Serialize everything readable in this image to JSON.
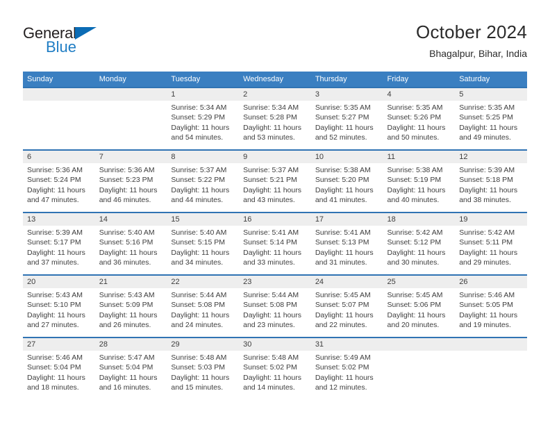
{
  "logo": {
    "word_one": "General",
    "word_two": "Blue",
    "triangle_color": "#0b6cb5",
    "text_color": "#231f20",
    "blue_color": "#1f7dc4"
  },
  "header": {
    "title": "October 2024",
    "subtitle": "Bhagalpur, Bihar, India"
  },
  "theme": {
    "header_row_bg": "#3a7fc1",
    "row_divider": "#2f73b3",
    "day_number_bg": "#eeeeee",
    "text": "#3d3d3d"
  },
  "weekday_headers": [
    "Sunday",
    "Monday",
    "Tuesday",
    "Wednesday",
    "Thursday",
    "Friday",
    "Saturday"
  ],
  "weeks": [
    [
      {
        "day": "",
        "sunrise": "",
        "sunset": "",
        "daylight": ""
      },
      {
        "day": "",
        "sunrise": "",
        "sunset": "",
        "daylight": ""
      },
      {
        "day": "1",
        "sunrise": "Sunrise: 5:34 AM",
        "sunset": "Sunset: 5:29 PM",
        "daylight": "Daylight: 11 hours and 54 minutes."
      },
      {
        "day": "2",
        "sunrise": "Sunrise: 5:34 AM",
        "sunset": "Sunset: 5:28 PM",
        "daylight": "Daylight: 11 hours and 53 minutes."
      },
      {
        "day": "3",
        "sunrise": "Sunrise: 5:35 AM",
        "sunset": "Sunset: 5:27 PM",
        "daylight": "Daylight: 11 hours and 52 minutes."
      },
      {
        "day": "4",
        "sunrise": "Sunrise: 5:35 AM",
        "sunset": "Sunset: 5:26 PM",
        "daylight": "Daylight: 11 hours and 50 minutes."
      },
      {
        "day": "5",
        "sunrise": "Sunrise: 5:35 AM",
        "sunset": "Sunset: 5:25 PM",
        "daylight": "Daylight: 11 hours and 49 minutes."
      }
    ],
    [
      {
        "day": "6",
        "sunrise": "Sunrise: 5:36 AM",
        "sunset": "Sunset: 5:24 PM",
        "daylight": "Daylight: 11 hours and 47 minutes."
      },
      {
        "day": "7",
        "sunrise": "Sunrise: 5:36 AM",
        "sunset": "Sunset: 5:23 PM",
        "daylight": "Daylight: 11 hours and 46 minutes."
      },
      {
        "day": "8",
        "sunrise": "Sunrise: 5:37 AM",
        "sunset": "Sunset: 5:22 PM",
        "daylight": "Daylight: 11 hours and 44 minutes."
      },
      {
        "day": "9",
        "sunrise": "Sunrise: 5:37 AM",
        "sunset": "Sunset: 5:21 PM",
        "daylight": "Daylight: 11 hours and 43 minutes."
      },
      {
        "day": "10",
        "sunrise": "Sunrise: 5:38 AM",
        "sunset": "Sunset: 5:20 PM",
        "daylight": "Daylight: 11 hours and 41 minutes."
      },
      {
        "day": "11",
        "sunrise": "Sunrise: 5:38 AM",
        "sunset": "Sunset: 5:19 PM",
        "daylight": "Daylight: 11 hours and 40 minutes."
      },
      {
        "day": "12",
        "sunrise": "Sunrise: 5:39 AM",
        "sunset": "Sunset: 5:18 PM",
        "daylight": "Daylight: 11 hours and 38 minutes."
      }
    ],
    [
      {
        "day": "13",
        "sunrise": "Sunrise: 5:39 AM",
        "sunset": "Sunset: 5:17 PM",
        "daylight": "Daylight: 11 hours and 37 minutes."
      },
      {
        "day": "14",
        "sunrise": "Sunrise: 5:40 AM",
        "sunset": "Sunset: 5:16 PM",
        "daylight": "Daylight: 11 hours and 36 minutes."
      },
      {
        "day": "15",
        "sunrise": "Sunrise: 5:40 AM",
        "sunset": "Sunset: 5:15 PM",
        "daylight": "Daylight: 11 hours and 34 minutes."
      },
      {
        "day": "16",
        "sunrise": "Sunrise: 5:41 AM",
        "sunset": "Sunset: 5:14 PM",
        "daylight": "Daylight: 11 hours and 33 minutes."
      },
      {
        "day": "17",
        "sunrise": "Sunrise: 5:41 AM",
        "sunset": "Sunset: 5:13 PM",
        "daylight": "Daylight: 11 hours and 31 minutes."
      },
      {
        "day": "18",
        "sunrise": "Sunrise: 5:42 AM",
        "sunset": "Sunset: 5:12 PM",
        "daylight": "Daylight: 11 hours and 30 minutes."
      },
      {
        "day": "19",
        "sunrise": "Sunrise: 5:42 AM",
        "sunset": "Sunset: 5:11 PM",
        "daylight": "Daylight: 11 hours and 29 minutes."
      }
    ],
    [
      {
        "day": "20",
        "sunrise": "Sunrise: 5:43 AM",
        "sunset": "Sunset: 5:10 PM",
        "daylight": "Daylight: 11 hours and 27 minutes."
      },
      {
        "day": "21",
        "sunrise": "Sunrise: 5:43 AM",
        "sunset": "Sunset: 5:09 PM",
        "daylight": "Daylight: 11 hours and 26 minutes."
      },
      {
        "day": "22",
        "sunrise": "Sunrise: 5:44 AM",
        "sunset": "Sunset: 5:08 PM",
        "daylight": "Daylight: 11 hours and 24 minutes."
      },
      {
        "day": "23",
        "sunrise": "Sunrise: 5:44 AM",
        "sunset": "Sunset: 5:08 PM",
        "daylight": "Daylight: 11 hours and 23 minutes."
      },
      {
        "day": "24",
        "sunrise": "Sunrise: 5:45 AM",
        "sunset": "Sunset: 5:07 PM",
        "daylight": "Daylight: 11 hours and 22 minutes."
      },
      {
        "day": "25",
        "sunrise": "Sunrise: 5:45 AM",
        "sunset": "Sunset: 5:06 PM",
        "daylight": "Daylight: 11 hours and 20 minutes."
      },
      {
        "day": "26",
        "sunrise": "Sunrise: 5:46 AM",
        "sunset": "Sunset: 5:05 PM",
        "daylight": "Daylight: 11 hours and 19 minutes."
      }
    ],
    [
      {
        "day": "27",
        "sunrise": "Sunrise: 5:46 AM",
        "sunset": "Sunset: 5:04 PM",
        "daylight": "Daylight: 11 hours and 18 minutes."
      },
      {
        "day": "28",
        "sunrise": "Sunrise: 5:47 AM",
        "sunset": "Sunset: 5:04 PM",
        "daylight": "Daylight: 11 hours and 16 minutes."
      },
      {
        "day": "29",
        "sunrise": "Sunrise: 5:48 AM",
        "sunset": "Sunset: 5:03 PM",
        "daylight": "Daylight: 11 hours and 15 minutes."
      },
      {
        "day": "30",
        "sunrise": "Sunrise: 5:48 AM",
        "sunset": "Sunset: 5:02 PM",
        "daylight": "Daylight: 11 hours and 14 minutes."
      },
      {
        "day": "31",
        "sunrise": "Sunrise: 5:49 AM",
        "sunset": "Sunset: 5:02 PM",
        "daylight": "Daylight: 11 hours and 12 minutes."
      },
      {
        "day": "",
        "sunrise": "",
        "sunset": "",
        "daylight": ""
      },
      {
        "day": "",
        "sunrise": "",
        "sunset": "",
        "daylight": ""
      }
    ]
  ]
}
